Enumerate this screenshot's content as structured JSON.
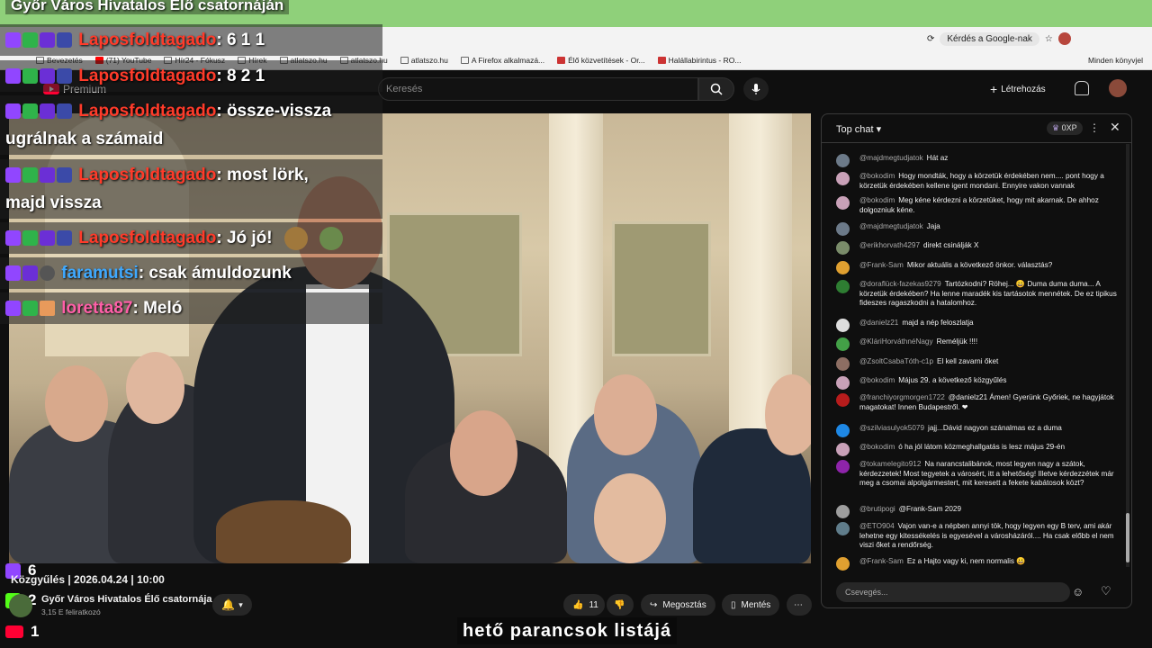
{
  "overlay": {
    "title": "Győr Város Hivatalos Élő csatornáján",
    "rows": [
      {
        "user": "Laposfoldtagado",
        "text": ": 6 1 1",
        "badges": [
          "twitch",
          "green",
          "star",
          "blue"
        ]
      },
      {
        "user": "Laposfoldtagado",
        "text": ": 8 2 1",
        "badges": [
          "twitch",
          "green",
          "star",
          "blue"
        ]
      },
      {
        "user": "Laposfoldtagado",
        "text": ": össze-vissza",
        "text2": "ugrálnak a számaid",
        "badges": [
          "twitch",
          "green",
          "star",
          "blue"
        ]
      },
      {
        "user": "Laposfoldtagado",
        "text": ": most lörk,",
        "text2": "majd vissza",
        "badges": [
          "twitch",
          "green",
          "star",
          "blue"
        ]
      },
      {
        "user": "Laposfoldtagado",
        "text": ": Jó jó!",
        "badges": [
          "twitch",
          "green",
          "star",
          "blue"
        ]
      },
      {
        "user": "faramutsi",
        "text": ": csak ámuldozunk",
        "badges": [
          "twitch",
          "star",
          "gray"
        ]
      },
      {
        "user": "loretta87",
        "text": ": Meló",
        "badges": [
          "twitch",
          "green",
          "avatar"
        ]
      }
    ],
    "counters": [
      {
        "platform": "twitch",
        "value": "6"
      },
      {
        "platform": "kick",
        "value": "2"
      },
      {
        "platform": "youtube",
        "value": "1"
      }
    ]
  },
  "browser": {
    "addr_right": "Kérdés a Google-nak",
    "bookmarks": [
      "Bevezetés",
      "(71) YouTube",
      "Hír24 - Fókusz",
      "Hírek",
      "atlatszo.hu",
      "atlatszo.hu",
      "atlatszo.hu",
      "A Firefox alkalmazá...",
      "Élő közvetítések - Or...",
      "Halállabirintus - RO..."
    ],
    "bookmarks_right": "Minden könyvjel"
  },
  "youtube": {
    "premium": "Premium",
    "search_placeholder": "Keresés",
    "create": "Létrehozás"
  },
  "video": {
    "title": "Közgyűlés | 2026.04.24 | 10:00",
    "channel": "Győr Város Hivatalos Élő csatornája",
    "subs": "3,15 E feliratkozó",
    "likes": "11",
    "share": "Megosztás",
    "save": "Mentés",
    "subtitle": "hető parancsok listájá"
  },
  "chat": {
    "title": "Top chat",
    "points": "0XP",
    "input_placeholder": "Csevegés...",
    "messages": [
      {
        "author": "@majdmegtudjatok",
        "text": "Hát az",
        "color": "#6c7a89"
      },
      {
        "author": "@bokodim",
        "text": "Hogy mondták, hogy a körzetük érdekében nem.... pont hogy a körzetük érdekében kellene igent mondani. Ennyire vakon vannak",
        "color": "#c9a1b8"
      },
      {
        "author": "@bokodim",
        "text": "Meg kéne kérdezni a körzetüket, hogy mit akarnak. De ahhoz dolgozniuk kéne.",
        "color": "#c9a1b8"
      },
      {
        "author": "@majdmegtudjatok",
        "text": "Jaja",
        "color": "#6c7a89"
      },
      {
        "author": "@erikhorvath4297",
        "text": "direkt csinálják X",
        "color": "#7a8c6a"
      },
      {
        "author": "@Frank-Sam",
        "text": "Mikor aktuális a következő önkor. választás?",
        "color": "#e0a030"
      },
      {
        "author": "@doraflück-fazekas9279",
        "text": "Tartózkodni? Röhej... 😀 Duma duma duma... A körzetük érdekében? Ha lenne maradék kis tartásotok mennétek. De ez tipikus fideszes ragaszkodni a hatalomhoz.",
        "color": "#2e7d32"
      },
      {
        "author": "@danielz21",
        "text": "majd a nép feloszlatja",
        "color": "#dddddd"
      },
      {
        "author": "@KláriHorváthnéNagy",
        "text": "Reméljük !!!!",
        "color": "#43a047"
      },
      {
        "author": "@ZsoltCsabaTóth-c1p",
        "text": "El kell zavarni őket",
        "color": "#8d6e63"
      },
      {
        "author": "@bokodim",
        "text": "Május 29. a következő közgyűlés",
        "color": "#c9a1b8"
      },
      {
        "author": "@franchiyorgmorgen1722",
        "text": "@danielz21 Ámen! Gyerünk Győriek, ne hagyjátok magatokat! Innen Budapestről. ❤",
        "color": "#b71c1c"
      },
      {
        "author": "@szilviasulyok5079",
        "text": "jajj...Dávid nagyon szánalmas ez a duma",
        "color": "#1e88e5"
      },
      {
        "author": "@bokodim",
        "text": "ó ha jól látom közmeghallgatás is lesz május 29-én",
        "color": "#c9a1b8"
      },
      {
        "author": "@tokamelegito912",
        "text": "Na narancstalibánok, most legyen nagy a szátok, kérdezzetek! Most tegyetek a városért, itt a lehetőség! Illetve kérdezzétek már meg a csomai alpolgármestert, mit keresett a fekete kabátosok közt?",
        "color": "#8e24aa"
      },
      {
        "author": "@brutipogi",
        "text": "@Frank-Sam 2029",
        "color": "#9e9e9e"
      },
      {
        "author": "@ETO904",
        "text": "Vajon van-e a népben annyi tök, hogy legyen egy B terv, ami akár lehetne egy kitessékelés is egyesével a városházáról.... Ha csak előbb el nem viszi őket a rendőrség.",
        "color": "#607d8b"
      },
      {
        "author": "@Frank-Sam",
        "text": "Ez a Hajto vagy ki, nem normalis 😀",
        "color": "#e0a030"
      }
    ]
  },
  "colors": {
    "accent": "#ff0033",
    "twitch": "#9146ff",
    "kick": "#53fc18"
  }
}
